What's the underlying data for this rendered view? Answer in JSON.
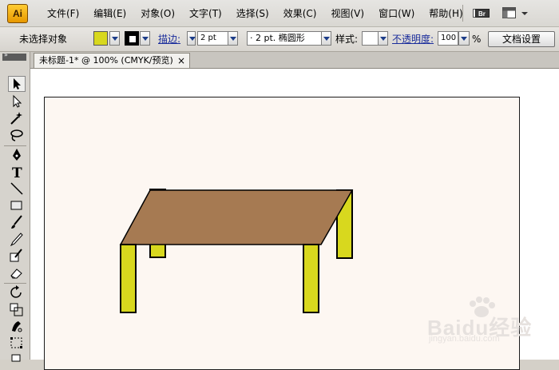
{
  "app": {
    "logo_text": "Ai"
  },
  "menu": [
    {
      "label": "文件(F)"
    },
    {
      "label": "编辑(E)"
    },
    {
      "label": "对象(O)"
    },
    {
      "label": "文字(T)"
    },
    {
      "label": "选择(S)"
    },
    {
      "label": "效果(C)"
    },
    {
      "label": "视图(V)"
    },
    {
      "label": "窗口(W)"
    },
    {
      "label": "帮助(H)"
    }
  ],
  "menu_right": {
    "bridge_label": "Br"
  },
  "control": {
    "selection_status": "未选择对象",
    "fill_color": "#d8d81e",
    "stroke_color": "#000000",
    "stroke_label": "描边:",
    "stroke_weight": "2 pt",
    "brush_profile": "· 2 pt. 椭圆形",
    "style_label": "样式:",
    "opacity_label": "不透明度:",
    "opacity_value": "100",
    "opacity_unit": "%",
    "doc_setup_button": "文档设置"
  },
  "tools_panel": {
    "collapse_glyph": "»"
  },
  "document_tab": {
    "title": "未标题-1* @ 100% (CMYK/预览)",
    "close_glyph": "×"
  },
  "artwork": {
    "tabletop_color": "#a67a52",
    "leg_color": "#d8d81e",
    "outline_color": "#000000"
  },
  "watermark": {
    "text": "Baidu经验",
    "subtext": "jingyan.baidu.com"
  }
}
